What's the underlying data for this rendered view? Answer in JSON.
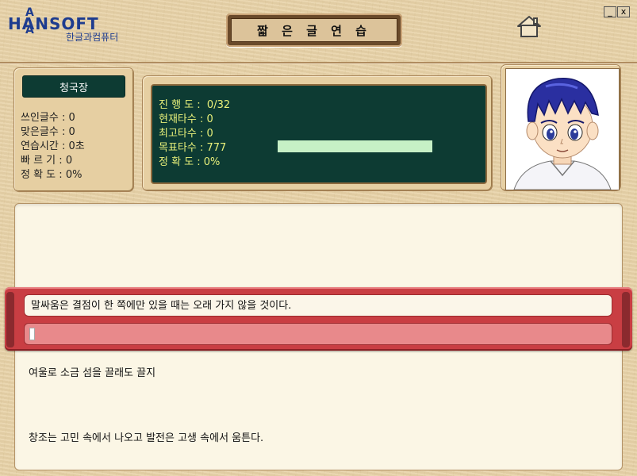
{
  "app": {
    "logo_main": "HANSOFT",
    "logo_letter_top": "A",
    "logo_letter_bottom": "A",
    "logo_subtitle": "한글과컴퓨터",
    "title": "짧 은 글  연 습",
    "minimize_label": "_",
    "close_label": "x"
  },
  "player": {
    "name": "청국장"
  },
  "stats": [
    {
      "label": "쓰인글수",
      "value": "0"
    },
    {
      "label": "맞은글수",
      "value": "0"
    },
    {
      "label": "연습시간",
      "value": "0초"
    },
    {
      "label": "빠 르 기",
      "value": "0"
    },
    {
      "label": "정 확 도",
      "value": "0%"
    }
  ],
  "board": {
    "progress": "진 행 도 :  0/32",
    "current_speed": "현재타수 : 0",
    "best_speed": "최고타수 : 0",
    "target_speed": "목표타수 : 777",
    "accuracy": "정 확 도 : 0%"
  },
  "practice": {
    "current_sentence": "말싸움은 결점이 한 쪽에만 있을 때는 오래 가지 않을 것이다.",
    "input_value": "",
    "next_sentences": [
      "여울로 소금 섬을 끌래도 끌지",
      "창조는 고민 속에서 나오고 발전은 고생 속에서 움튼다."
    ]
  },
  "colors": {
    "board_bg": "#0d3b33",
    "board_text": "#e8f07a",
    "accent_red": "#c93e43",
    "logo_blue": "#1e3c8f"
  },
  "icons": [
    "home-icon"
  ]
}
